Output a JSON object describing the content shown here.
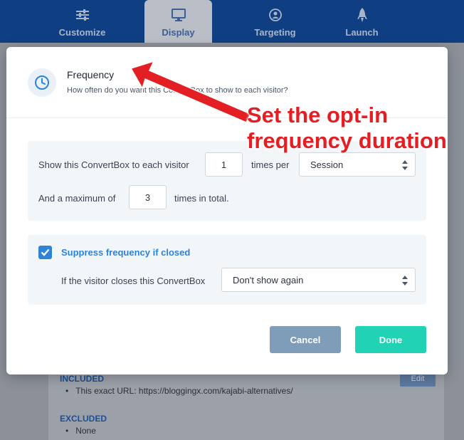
{
  "nav": {
    "tabs": [
      {
        "label": "Customize",
        "icon": "sliders-icon"
      },
      {
        "label": "Display",
        "icon": "monitor-icon",
        "active": true
      },
      {
        "label": "Targeting",
        "icon": "target-icon"
      },
      {
        "label": "Launch",
        "icon": "rocket-icon"
      }
    ]
  },
  "background": {
    "included_label": "INCLUDED",
    "included_item": "This exact URL: https://bloggingx.com/kajabi-alternatives/",
    "excluded_label": "EXCLUDED",
    "excluded_item": "None",
    "edit_label": "Edit"
  },
  "modal": {
    "title": "Frequency",
    "subtitle": "How often do you want this ConvertBox to show to each visitor?",
    "icon": "clock-icon",
    "frequency": {
      "show_label": "Show this ConvertBox to each visitor",
      "times_value": "1",
      "times_per_label": "times per",
      "period_value": "Session",
      "max_label": "And a maximum of",
      "max_value": "3",
      "total_label": "times in total."
    },
    "suppress": {
      "checked": true,
      "label": "Suppress frequency if closed",
      "closes_label": "If the visitor closes this ConvertBox",
      "closes_value": "Don't show again"
    },
    "cancel_label": "Cancel",
    "done_label": "Done"
  },
  "annotation": {
    "line1": "Set the opt-in",
    "line2": "frequency duration"
  },
  "colors": {
    "accent": "#2e83d8",
    "done": "#21d2b4",
    "cancel": "#7f9cb8",
    "annotation": "#e41f24",
    "nav": "#0f3f82"
  }
}
